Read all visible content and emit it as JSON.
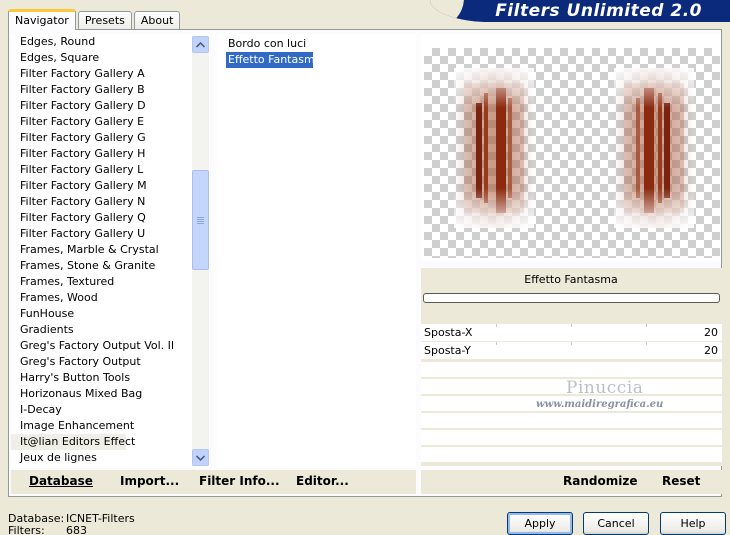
{
  "header": {
    "title": "Filters Unlimited 2.0"
  },
  "tabs": [
    {
      "label": "Navigator",
      "active": true
    },
    {
      "label": "Presets",
      "active": false
    },
    {
      "label": "About",
      "active": false
    }
  ],
  "categories": [
    "Edges, Round",
    "Edges, Square",
    "Filter Factory Gallery A",
    "Filter Factory Gallery B",
    "Filter Factory Gallery D",
    "Filter Factory Gallery E",
    "Filter Factory Gallery G",
    "Filter Factory Gallery H",
    "Filter Factory Gallery L",
    "Filter Factory Gallery M",
    "Filter Factory Gallery N",
    "Filter Factory Gallery Q",
    "Filter Factory Gallery U",
    "Frames, Marble & Crystal",
    "Frames, Stone & Granite",
    "Frames, Textured",
    "Frames, Wood",
    "FunHouse",
    "Gradients",
    "Greg's Factory Output Vol. II",
    "Greg's Factory Output",
    "Harry's Button Tools",
    "Horizonaus Mixed Bag",
    "I-Decay",
    "Image Enhancement",
    "It@lian Editors Effect",
    "Jeux de lignes"
  ],
  "highlighted_category": "It@lian Editors Effect",
  "effects": [
    {
      "label": "Bordo con luci",
      "selected": false
    },
    {
      "label": "Effetto Fantasma",
      "selected": true
    }
  ],
  "preview": {
    "filter_name": "Effetto Fantasma"
  },
  "params": [
    {
      "label": "Sposta-X",
      "value": "20"
    },
    {
      "label": "Sposta-Y",
      "value": "20"
    }
  ],
  "watermark": {
    "name": "Pinuccia",
    "site": "www.maidiregrafica.eu"
  },
  "left_buttons": [
    {
      "label": "Database"
    },
    {
      "label": "Import..."
    },
    {
      "label": "Filter Info..."
    },
    {
      "label": "Editor..."
    }
  ],
  "right_buttons": [
    {
      "label": "Randomize"
    },
    {
      "label": "Reset"
    }
  ],
  "status": {
    "database_label": "Database:",
    "database_value": "ICNET-Filters",
    "filters_label": "Filters:",
    "filters_value": "683"
  },
  "dialog_buttons": {
    "apply": "Apply",
    "cancel": "Cancel",
    "help": "Help"
  },
  "colors": {
    "banner": "#0c2a7c",
    "selection": "#316ac5",
    "effect_brown": "#8b2a0e"
  },
  "scrollbar": {
    "position_fraction": 0.36
  }
}
